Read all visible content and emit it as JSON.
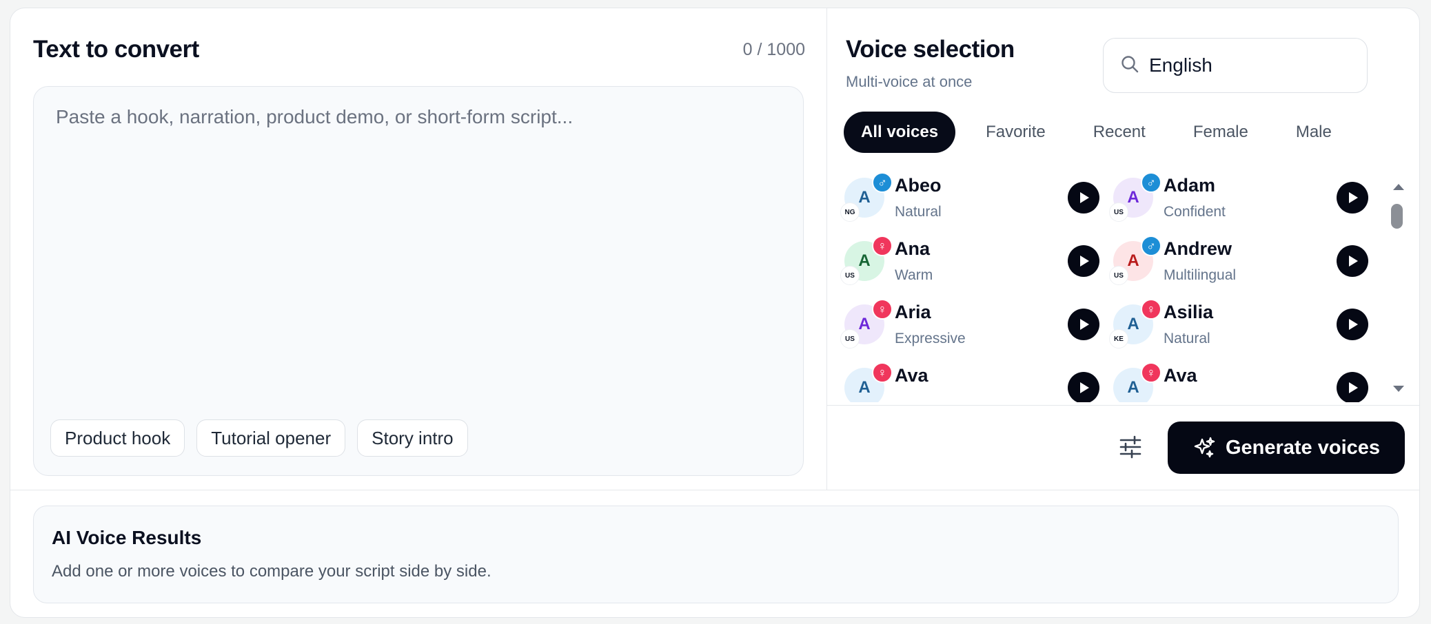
{
  "left": {
    "title": "Text to convert",
    "counter": "0 / 1000",
    "placeholder": "Paste a hook, narration, product demo, or short-form script...",
    "chips": [
      "Product hook",
      "Tutorial opener",
      "Story intro"
    ]
  },
  "right": {
    "title": "Voice selection",
    "subtitle": "Multi-voice at once",
    "search_value": "English",
    "filters": [
      "All voices",
      "Favorite",
      "Recent",
      "Female",
      "Male"
    ],
    "active_filter": "All voices",
    "voices": [
      {
        "name": "Abeo",
        "style": "Natural",
        "country": "NG",
        "gender": "male",
        "initial": "A",
        "bg": "#e3f1fc",
        "fg": "#1f5f93"
      },
      {
        "name": "Adam",
        "style": "Confident",
        "country": "US",
        "gender": "male",
        "initial": "A",
        "bg": "#efe7fb",
        "fg": "#6d28d9"
      },
      {
        "name": "Ana",
        "style": "Warm",
        "country": "US",
        "gender": "female",
        "initial": "A",
        "bg": "#d8f5e4",
        "fg": "#166534"
      },
      {
        "name": "Andrew",
        "style": "Multilingual",
        "country": "US",
        "gender": "male",
        "initial": "A",
        "bg": "#fde4e6",
        "fg": "#b91c1c"
      },
      {
        "name": "Aria",
        "style": "Expressive",
        "country": "US",
        "gender": "female",
        "initial": "A",
        "bg": "#efe7fb",
        "fg": "#6d28d9"
      },
      {
        "name": "Asilia",
        "style": "Natural",
        "country": "KE",
        "gender": "female",
        "initial": "A",
        "bg": "#e3f1fc",
        "fg": "#1f5f93"
      },
      {
        "name": "Ava",
        "style": "",
        "country": "",
        "gender": "female",
        "initial": "A",
        "bg": "#e3f1fc",
        "fg": "#1f5f93"
      },
      {
        "name": "Ava",
        "style": "",
        "country": "",
        "gender": "female",
        "initial": "A",
        "bg": "#e3f1fc",
        "fg": "#1f5f93"
      }
    ],
    "generate_label": "Generate voices"
  },
  "results": {
    "title": "AI Voice Results",
    "subtitle": "Add one or more voices to compare your script side by side."
  },
  "icons": {
    "search": "search-icon",
    "play": "play-icon",
    "settings": "sliders-icon",
    "spark": "sparkles-icon",
    "male": "male-symbol-icon",
    "female": "female-symbol-icon"
  },
  "colors": {
    "dark": "#050814",
    "male_badge": "#1d8ed6",
    "female_badge": "#f0365c"
  }
}
